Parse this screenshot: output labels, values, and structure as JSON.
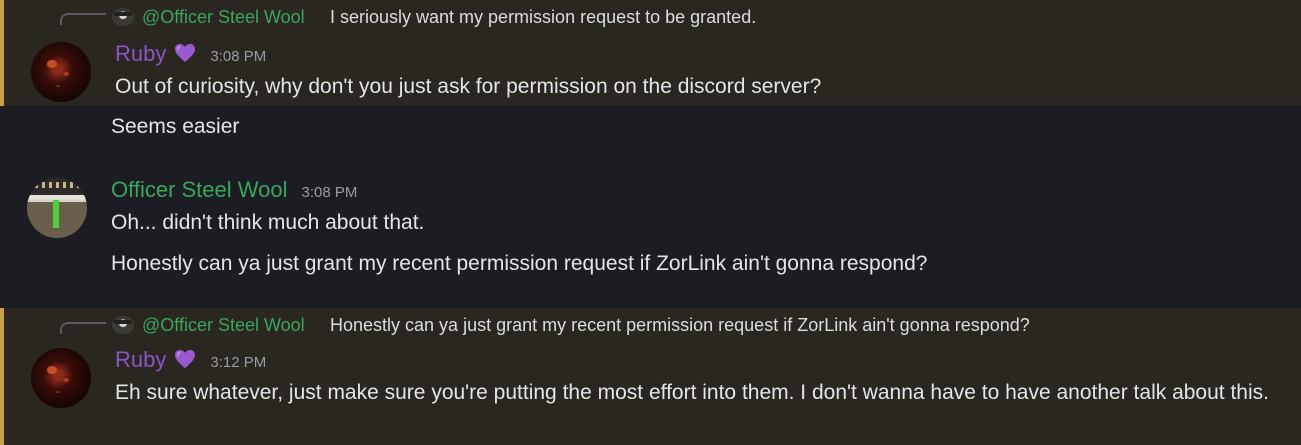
{
  "messages": [
    {
      "reply": {
        "name": "@Officer Steel Wool",
        "text": "I seriously want my permission request to be granted."
      },
      "author": "Ruby",
      "time": "3:08 PM",
      "lines": [
        "Out of curiosity, why don't you just ask for permission on the discord server?"
      ]
    },
    {
      "lines": [
        "Seems easier"
      ]
    },
    {
      "author": "Officer Steel Wool",
      "time": "3:08 PM",
      "lines": [
        "Oh... didn't think much about that.",
        "Honestly can ya just grant my recent permission request if ZorLink ain't gonna respond?"
      ]
    },
    {
      "reply": {
        "name": "@Officer Steel Wool",
        "text": "Honestly can ya just grant my recent permission request if ZorLink ain't gonna respond?"
      },
      "author": "Ruby",
      "time": "3:12 PM",
      "lines": [
        "Eh sure whatever, just make sure you're putting the most effort into them. I don't wanna have to have another talk about this."
      ]
    }
  ],
  "colors": {
    "ruby": "#8a55c7",
    "wool": "#3ba55d",
    "mention_bar": "#c9a048",
    "heart": "#9b59d0"
  },
  "icons": {
    "heart": "purple-heart-icon"
  }
}
